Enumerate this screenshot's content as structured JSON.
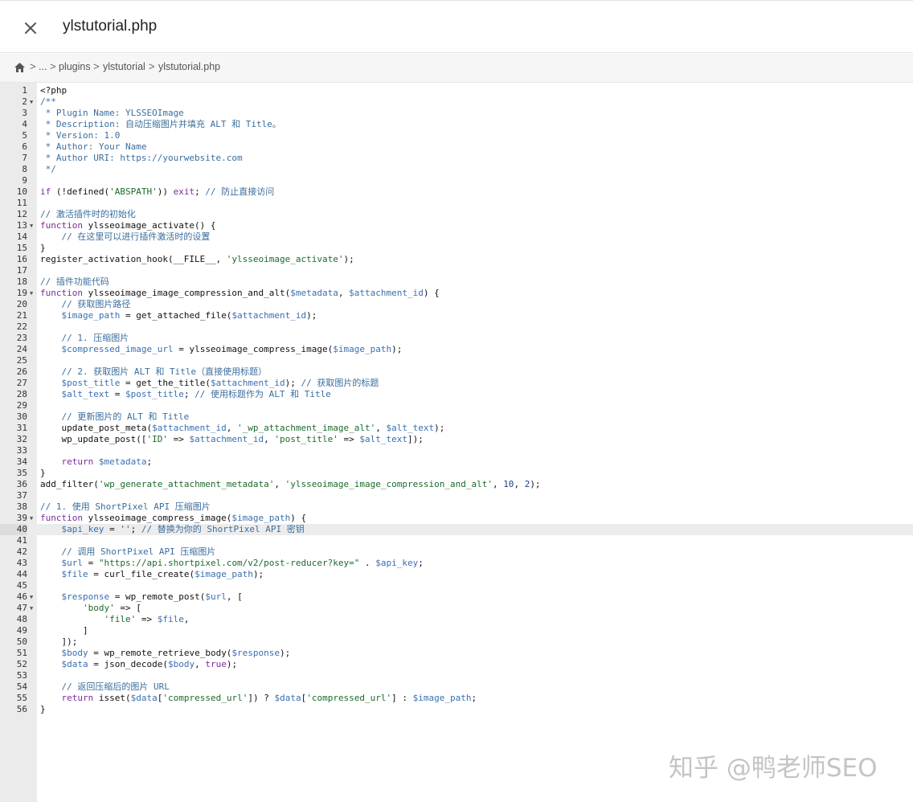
{
  "header": {
    "title": "ylstutorial.php",
    "close_icon": "close-icon"
  },
  "breadcrumb": {
    "home_icon": "home-icon",
    "ellipsis": "...",
    "items": [
      "plugins",
      "ylstutorial",
      "ylstutorial.php"
    ],
    "separator": ">"
  },
  "editor": {
    "active_line": 40,
    "lines": [
      {
        "n": "1",
        "fold": false,
        "code": "<?php"
      },
      {
        "n": "2",
        "fold": true,
        "code": "/**"
      },
      {
        "n": "3",
        "fold": false,
        "code": " * Plugin Name: YLSSEOImage"
      },
      {
        "n": "4",
        "fold": false,
        "code": " * Description: 自动压缩图片并填充 ALT 和 Title。"
      },
      {
        "n": "5",
        "fold": false,
        "code": " * Version: 1.0"
      },
      {
        "n": "6",
        "fold": false,
        "code": " * Author: Your Name"
      },
      {
        "n": "7",
        "fold": false,
        "code": " * Author URI: https://yourwebsite.com"
      },
      {
        "n": "8",
        "fold": false,
        "code": " */"
      },
      {
        "n": "9",
        "fold": false,
        "code": ""
      },
      {
        "n": "10",
        "fold": false,
        "code": "if (!defined('ABSPATH')) exit; // 防止直接访问"
      },
      {
        "n": "11",
        "fold": false,
        "code": ""
      },
      {
        "n": "12",
        "fold": false,
        "code": "// 激活插件时的初始化"
      },
      {
        "n": "13",
        "fold": true,
        "code": "function ylsseoimage_activate() {"
      },
      {
        "n": "14",
        "fold": false,
        "code": "    // 在这里可以进行插件激活时的设置"
      },
      {
        "n": "15",
        "fold": false,
        "code": "}"
      },
      {
        "n": "16",
        "fold": false,
        "code": "register_activation_hook(__FILE__, 'ylsseoimage_activate');"
      },
      {
        "n": "17",
        "fold": false,
        "code": ""
      },
      {
        "n": "18",
        "fold": false,
        "code": "// 插件功能代码"
      },
      {
        "n": "19",
        "fold": true,
        "code": "function ylsseoimage_image_compression_and_alt($metadata, $attachment_id) {"
      },
      {
        "n": "20",
        "fold": false,
        "code": "    // 获取图片路径"
      },
      {
        "n": "21",
        "fold": false,
        "code": "    $image_path = get_attached_file($attachment_id);"
      },
      {
        "n": "22",
        "fold": false,
        "code": ""
      },
      {
        "n": "23",
        "fold": false,
        "code": "    // 1. 压缩图片"
      },
      {
        "n": "24",
        "fold": false,
        "code": "    $compressed_image_url = ylsseoimage_compress_image($image_path);"
      },
      {
        "n": "25",
        "fold": false,
        "code": ""
      },
      {
        "n": "26",
        "fold": false,
        "code": "    // 2. 获取图片 ALT 和 Title（直接使用标题）"
      },
      {
        "n": "27",
        "fold": false,
        "code": "    $post_title = get_the_title($attachment_id); // 获取图片的标题"
      },
      {
        "n": "28",
        "fold": false,
        "code": "    $alt_text = $post_title; // 使用标题作为 ALT 和 Title"
      },
      {
        "n": "29",
        "fold": false,
        "code": ""
      },
      {
        "n": "30",
        "fold": false,
        "code": "    // 更新图片的 ALT 和 Title"
      },
      {
        "n": "31",
        "fold": false,
        "code": "    update_post_meta($attachment_id, '_wp_attachment_image_alt', $alt_text);"
      },
      {
        "n": "32",
        "fold": false,
        "code": "    wp_update_post(['ID' => $attachment_id, 'post_title' => $alt_text]);"
      },
      {
        "n": "33",
        "fold": false,
        "code": ""
      },
      {
        "n": "34",
        "fold": false,
        "code": "    return $metadata;"
      },
      {
        "n": "35",
        "fold": false,
        "code": "}"
      },
      {
        "n": "36",
        "fold": false,
        "code": "add_filter('wp_generate_attachment_metadata', 'ylsseoimage_image_compression_and_alt', 10, 2);"
      },
      {
        "n": "37",
        "fold": false,
        "code": ""
      },
      {
        "n": "38",
        "fold": false,
        "code": "// 1. 使用 ShortPixel API 压缩图片"
      },
      {
        "n": "39",
        "fold": true,
        "code": "function ylsseoimage_compress_image($image_path) {"
      },
      {
        "n": "40",
        "fold": false,
        "code": "    $api_key = '\u0000'; // 替换为你的 ShortPixel API 密钥"
      },
      {
        "n": "41",
        "fold": false,
        "code": ""
      },
      {
        "n": "42",
        "fold": false,
        "code": "    // 调用 ShortPixel API 压缩图片"
      },
      {
        "n": "43",
        "fold": false,
        "code": "    $url = \"https://api.shortpixel.com/v2/post-reducer?key=\" . $api_key;"
      },
      {
        "n": "44",
        "fold": false,
        "code": "    $file = curl_file_create($image_path);"
      },
      {
        "n": "45",
        "fold": false,
        "code": ""
      },
      {
        "n": "46",
        "fold": true,
        "code": "    $response = wp_remote_post($url, ["
      },
      {
        "n": "47",
        "fold": true,
        "code": "        'body' => ["
      },
      {
        "n": "48",
        "fold": false,
        "code": "            'file' => $file,"
      },
      {
        "n": "49",
        "fold": false,
        "code": "        ]"
      },
      {
        "n": "50",
        "fold": false,
        "code": "    ]);"
      },
      {
        "n": "51",
        "fold": false,
        "code": "    $body = wp_remote_retrieve_body($response);"
      },
      {
        "n": "52",
        "fold": false,
        "code": "    $data = json_decode($body, true);"
      },
      {
        "n": "53",
        "fold": false,
        "code": ""
      },
      {
        "n": "54",
        "fold": false,
        "code": "    // 返回压缩后的图片 URL"
      },
      {
        "n": "55",
        "fold": false,
        "code": "    return isset($data['compressed_url']) ? $data['compressed_url'] : $image_path;"
      },
      {
        "n": "56",
        "fold": false,
        "code": "}"
      }
    ]
  },
  "watermark": "知乎 @鸭老师SEO",
  "colors": {
    "comment": "#3b6e9e",
    "keyword": "#7a2c9a",
    "string": "#1b6b2a",
    "variable": "#3a6fb0",
    "gutter": "#ebebeb"
  }
}
